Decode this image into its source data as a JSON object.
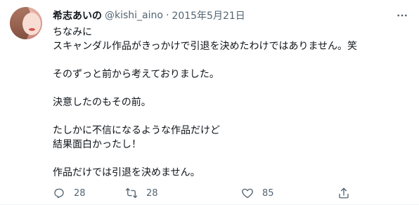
{
  "author": {
    "name": "希志あいの",
    "handle": "@kishi_aino",
    "separator": "·",
    "date": "2015年5月21日"
  },
  "tweet": {
    "lines": [
      "ちなみに",
      "スキャンダル作品がきっかけで引退を決めたわけではありません。笑",
      "",
      "そのずっと前から考えておりました。",
      "",
      "決意したのもその前。",
      "",
      "たしかに不信になるような作品だけど",
      "結果面白かったし！",
      "",
      "作品だけでは引退を決めません。"
    ]
  },
  "actions": {
    "reply": {
      "icon": "reply-icon",
      "count": "28"
    },
    "retweet": {
      "icon": "retweet-icon",
      "count": "28"
    },
    "like": {
      "icon": "heart-icon",
      "count": "85"
    },
    "share": {
      "icon": "share-icon"
    }
  },
  "colors": {
    "text": "#0f1419",
    "secondary": "#536471"
  }
}
